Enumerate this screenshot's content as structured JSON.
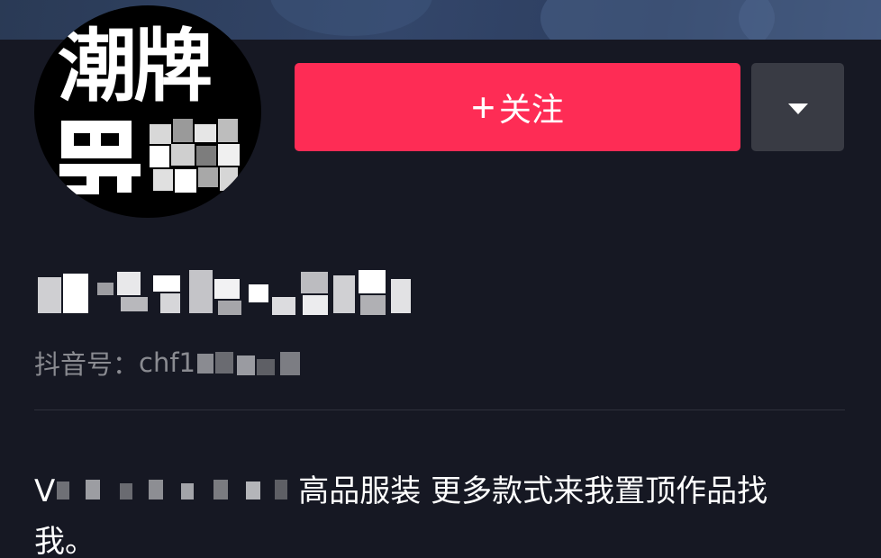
{
  "profile": {
    "avatar_text_line1": "潮牌",
    "follow_label": "关注",
    "follow_plus": "+",
    "id_label": "抖音号：",
    "id_prefix": "chf1",
    "bio_prefix": "V",
    "bio_line1": "高品服装 更多款式来我置顶作品找",
    "bio_line2": "我。"
  },
  "colors": {
    "background": "#161823",
    "follow_button": "#fe2c55",
    "more_button": "#393b44",
    "secondary_text": "#8a8b91"
  },
  "icons": {
    "more": "caret-down-icon",
    "follow": "plus-icon"
  }
}
